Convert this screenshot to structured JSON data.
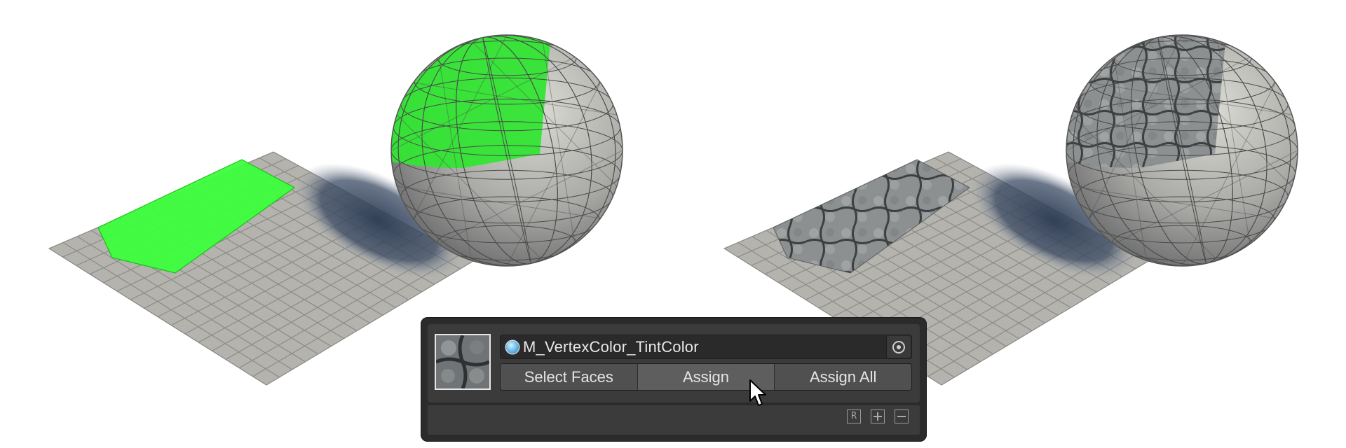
{
  "material": {
    "name": "M_VertexColor_TintColor",
    "icon": "material-sphere-icon",
    "picker_icon": "object-picker-icon"
  },
  "buttons": {
    "select_faces": "Select Faces",
    "assign": "Assign",
    "assign_all": "Assign All"
  },
  "footer": {
    "reset_icon_label": "R",
    "icons": [
      "reset-icon",
      "add-icon",
      "remove-icon"
    ]
  },
  "colors": {
    "selection_green": "#33ff33",
    "panel_bg": "#2b2b2b",
    "row_bg": "#3b3b3b",
    "button_bg": "#505050",
    "shadow": "#2e3d55"
  }
}
